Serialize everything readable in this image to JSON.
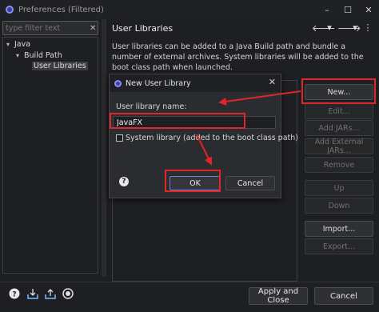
{
  "window": {
    "title": "Preferences (Filtered)",
    "controls": [
      "–",
      "☐",
      "✕"
    ]
  },
  "filter": {
    "placeholder": "type filter text",
    "clear_glyph": "✕"
  },
  "tree": {
    "items": [
      {
        "label": "Java",
        "arrow": "▾"
      },
      {
        "label": "Build Path",
        "arrow": "▾"
      },
      {
        "label": "User Libraries",
        "arrow": ""
      }
    ]
  },
  "page": {
    "title": "User Libraries",
    "nav_glyphs": [
      "🡐",
      "▾",
      "🡒",
      "▾",
      "⋮"
    ],
    "description": "User libraries can be added to a Java Build path and bundle a number of external archives. System libraries will be added to the boot class path when launched."
  },
  "side_buttons": [
    {
      "label": "New...",
      "enabled": true
    },
    {
      "label": "Edit...",
      "enabled": false
    },
    {
      "label": "Add JARs...",
      "enabled": false
    },
    {
      "label": "Add External JARs...",
      "enabled": false
    },
    {
      "label": "Remove",
      "enabled": false
    },
    {
      "label": "Up",
      "enabled": false
    },
    {
      "label": "Down",
      "enabled": false
    },
    {
      "label": "Import...",
      "enabled": true
    },
    {
      "label": "Export...",
      "enabled": false
    }
  ],
  "footer": {
    "apply_close": "Apply and Close",
    "cancel": "Cancel",
    "icons": [
      "help-icon",
      "import-icon",
      "export-icon",
      "record-icon"
    ]
  },
  "dialog": {
    "title": "New User Library",
    "close_glyph": "✕",
    "name_label": "User library name:",
    "name_value": "JavaFX",
    "system_label": "System library (added to the boot class path)",
    "system_checked": false,
    "ok": "OK",
    "cancel": "Cancel",
    "help_glyph": "?"
  },
  "colors": {
    "accent_highlight": "#e0262a",
    "background": "#1e1f22",
    "dialog_bg": "#2b2c2f"
  }
}
